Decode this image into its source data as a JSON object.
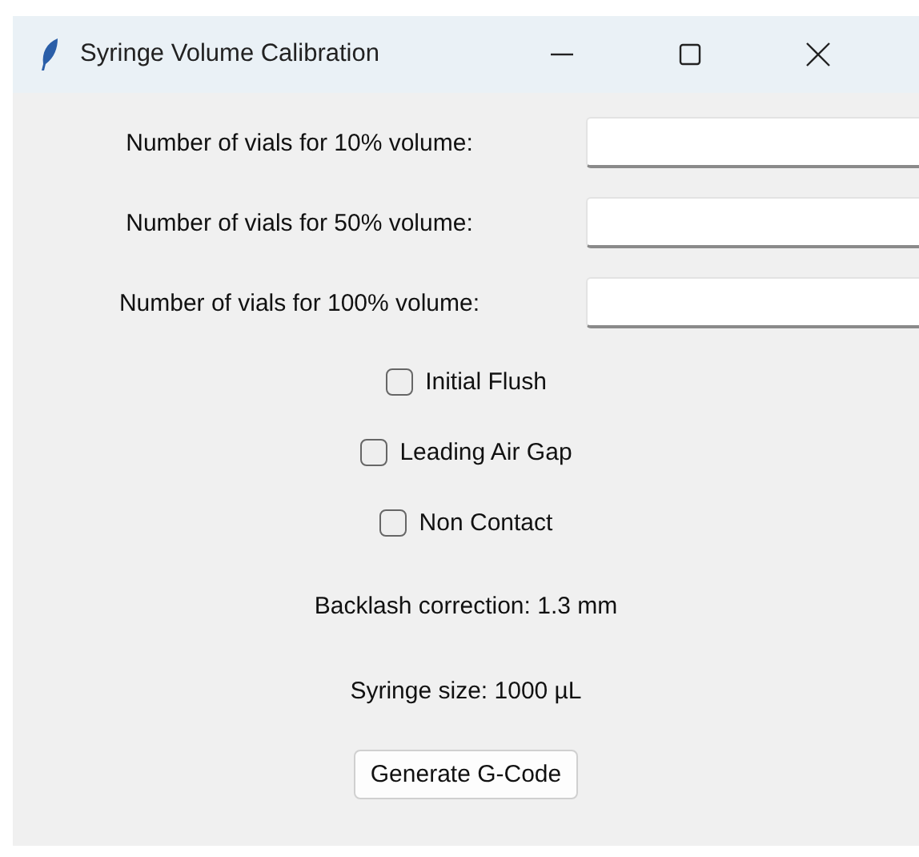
{
  "window": {
    "title": "Syringe Volume Calibration"
  },
  "fields": [
    {
      "label": "Number of vials for 10% volume:"
    },
    {
      "label": "Number of vials for 50% volume:"
    },
    {
      "label": "Number of vials for 100% volume:"
    }
  ],
  "checkboxes": [
    {
      "label": "Initial Flush",
      "checked": false
    },
    {
      "label": "Leading Air Gap",
      "checked": false
    },
    {
      "label": "Non Contact",
      "checked": false
    }
  ],
  "info": [
    "Backlash correction: 1.3 mm",
    "Syringe size: 1000 µL"
  ],
  "button": "Generate G-Code"
}
